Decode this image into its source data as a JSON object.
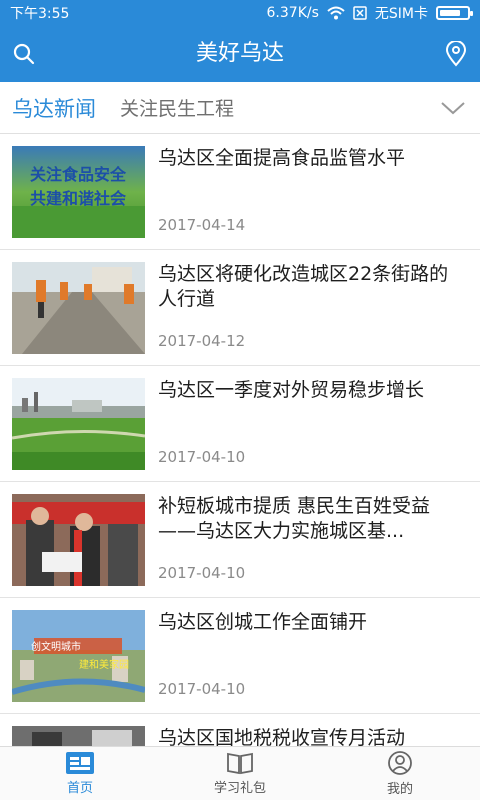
{
  "status_bar": {
    "time": "下午3:55",
    "network_speed": "6.37K/s",
    "sim_text": "无SIM卡",
    "battery_level": 0.8
  },
  "header": {
    "title": "美好乌达",
    "search_icon": "search-icon",
    "location_icon": "location-pin-icon"
  },
  "tabs": [
    {
      "label": "乌达新闻",
      "active": true
    },
    {
      "label": "关注民生工程",
      "active": false
    }
  ],
  "news": [
    {
      "title": "乌达区全面提高食品监管水平",
      "date": "2017-04-14",
      "thumb_lines": [
        "关注食品安全",
        "共建和谐社会"
      ]
    },
    {
      "title": "乌达区将硬化改造城区22条街路的人行道",
      "date": "2017-04-12"
    },
    {
      "title": "乌达区一季度对外贸易稳步增长",
      "date": "2017-04-10"
    },
    {
      "title": "补短板城市提质 惠民生百姓受益 ——乌达区大力实施城区基...",
      "date": "2017-04-10"
    },
    {
      "title": "乌达区创城工作全面铺开",
      "date": "2017-04-10",
      "thumb_lines": [
        "创文明城市",
        "建和美家园"
      ]
    },
    {
      "title": "乌达区国地税税收宣传月活动",
      "date": ""
    }
  ],
  "bottom_nav": [
    {
      "label": "首页",
      "icon": "home-news-icon",
      "active": true
    },
    {
      "label": "学习礼包",
      "icon": "book-icon",
      "active": false
    },
    {
      "label": "我的",
      "icon": "user-icon",
      "active": false
    }
  ],
  "colors": {
    "primary": "#2a8ad8",
    "date": "#8a8a8a",
    "title": "#1e1e1e"
  }
}
